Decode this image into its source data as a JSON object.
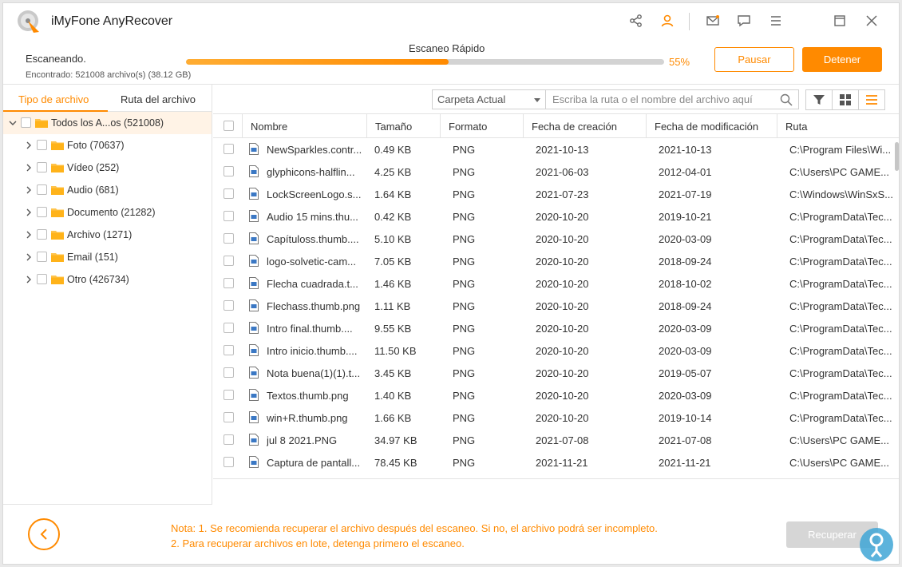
{
  "app": {
    "title": "iMyFone AnyRecover",
    "accent_color": "#ff8a00",
    "logo_icon": "disk-recover-logo-icon"
  },
  "titlebar": {
    "icons": [
      "share-icon",
      "user-icon",
      "mail-icon",
      "feedback-icon",
      "menu-icon",
      "maximize-icon",
      "close-icon"
    ]
  },
  "scan": {
    "status": "Escaneando.",
    "found": "Encontrado: 521008 archivo(s) (38.12 GB)",
    "mode": "Escaneo Rápido",
    "progress_percent": 55,
    "progress_label": "55%",
    "pause_label": "Pausar",
    "stop_label": "Detener"
  },
  "left_panel": {
    "tabs": [
      "Tipo de archivo",
      "Ruta del archivo"
    ],
    "active_tab": 0,
    "root": "Todos los A...os (521008)",
    "items": [
      "Foto (70637)",
      "Vídeo (252)",
      "Audio (681)",
      "Documento (21282)",
      "Archivo (1271)",
      "Email (151)",
      "Otro (426734)"
    ]
  },
  "toolbar": {
    "folder_select": "Carpeta Actual",
    "path_placeholder": "Escriba la ruta o el nombre del archivo aquí"
  },
  "table": {
    "columns": [
      "Nombre",
      "Tamaño",
      "Formato",
      "Fecha de creación",
      "Fecha de modificación",
      "Ruta"
    ],
    "rows": [
      {
        "name": "NewSparkles.contr...",
        "size": "0.49 KB",
        "format": "PNG",
        "created": "2021-10-13",
        "modified": "2021-10-13",
        "path": "C:\\Program Files\\Wi..."
      },
      {
        "name": "glyphicons-halflin...",
        "size": "4.25 KB",
        "format": "PNG",
        "created": "2021-06-03",
        "modified": "2012-04-01",
        "path": "C:\\Users\\PC GAME..."
      },
      {
        "name": "LockScreenLogo.s...",
        "size": "1.64 KB",
        "format": "PNG",
        "created": "2021-07-23",
        "modified": "2021-07-19",
        "path": "C:\\Windows\\WinSxS..."
      },
      {
        "name": "Audio 15 mins.thu...",
        "size": "0.42 KB",
        "format": "PNG",
        "created": "2020-10-20",
        "modified": "2019-10-21",
        "path": "C:\\ProgramData\\Tec..."
      },
      {
        "name": "Capítuloss.thumb....",
        "size": "5.10 KB",
        "format": "PNG",
        "created": "2020-10-20",
        "modified": "2020-03-09",
        "path": "C:\\ProgramData\\Tec..."
      },
      {
        "name": "logo-solvetic-cam...",
        "size": "7.05 KB",
        "format": "PNG",
        "created": "2020-10-20",
        "modified": "2018-09-24",
        "path": "C:\\ProgramData\\Tec..."
      },
      {
        "name": "Flecha cuadrada.t...",
        "size": "1.46 KB",
        "format": "PNG",
        "created": "2020-10-20",
        "modified": "2018-10-02",
        "path": "C:\\ProgramData\\Tec..."
      },
      {
        "name": "Flechass.thumb.png",
        "size": "1.11 KB",
        "format": "PNG",
        "created": "2020-10-20",
        "modified": "2018-09-24",
        "path": "C:\\ProgramData\\Tec..."
      },
      {
        "name": "Intro final.thumb....",
        "size": "9.55 KB",
        "format": "PNG",
        "created": "2020-10-20",
        "modified": "2020-03-09",
        "path": "C:\\ProgramData\\Tec..."
      },
      {
        "name": "Intro inicio.thumb....",
        "size": "11.50 KB",
        "format": "PNG",
        "created": "2020-10-20",
        "modified": "2020-03-09",
        "path": "C:\\ProgramData\\Tec..."
      },
      {
        "name": "Nota buena(1)(1).t...",
        "size": "3.45 KB",
        "format": "PNG",
        "created": "2020-10-20",
        "modified": "2019-05-07",
        "path": "C:\\ProgramData\\Tec..."
      },
      {
        "name": "Textos.thumb.png",
        "size": "1.40 KB",
        "format": "PNG",
        "created": "2020-10-20",
        "modified": "2020-03-09",
        "path": "C:\\ProgramData\\Tec..."
      },
      {
        "name": "win+R.thumb.png",
        "size": "1.66 KB",
        "format": "PNG",
        "created": "2020-10-20",
        "modified": "2019-10-14",
        "path": "C:\\ProgramData\\Tec..."
      },
      {
        "name": "jul 8 2021.PNG",
        "size": "34.97 KB",
        "format": "PNG",
        "created": "2021-07-08",
        "modified": "2021-07-08",
        "path": "C:\\Users\\PC GAME..."
      },
      {
        "name": "Captura de pantall...",
        "size": "78.45 KB",
        "format": "PNG",
        "created": "2021-11-21",
        "modified": "2021-11-21",
        "path": "C:\\Users\\PC GAME..."
      }
    ]
  },
  "footer": {
    "note_line1": "Nota: 1. Se recomienda recuperar el archivo después del escaneo. Si no, el archivo podrá ser incompleto.",
    "note_line2": "2. Para recuperar archivos en lote, detenga primero el escaneo.",
    "recover_label": "Recuperar"
  }
}
